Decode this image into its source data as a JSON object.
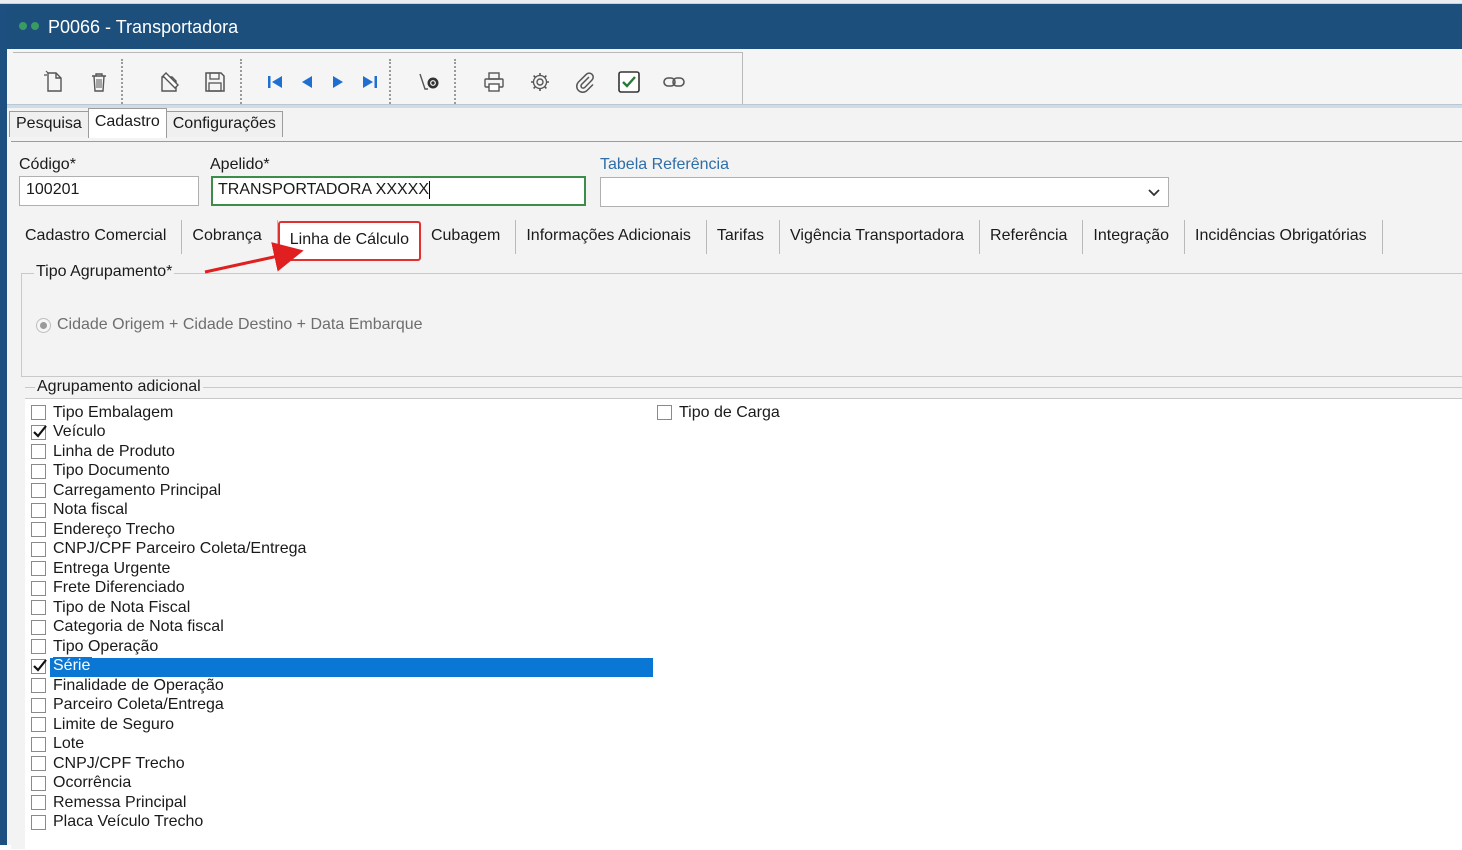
{
  "window": {
    "title": "P0066 - Transportadora"
  },
  "toolbar": {
    "buttons": [
      {
        "name": "new-icon"
      },
      {
        "name": "delete-icon"
      },
      {
        "name": "edit-icon"
      },
      {
        "name": "save-icon"
      },
      {
        "name": "first-icon"
      },
      {
        "name": "previous-icon"
      },
      {
        "name": "next-icon"
      },
      {
        "name": "last-icon"
      },
      {
        "name": "search-records-icon"
      },
      {
        "name": "print-icon"
      },
      {
        "name": "settings-icon"
      },
      {
        "name": "attach-icon"
      },
      {
        "name": "checklist-icon"
      },
      {
        "name": "link-icon"
      }
    ]
  },
  "main_tabs": [
    {
      "label": "Pesquisa"
    },
    {
      "label": "Cadastro"
    },
    {
      "label": "Configurações"
    }
  ],
  "form": {
    "codigo_label": "Código*",
    "codigo_value": "100201",
    "apelido_label": "Apelido*",
    "apelido_value": "TRANSPORTADORA XXXXX",
    "tabela_label": "Tabela Referência",
    "tabela_value": ""
  },
  "sub_tabs": [
    {
      "label": "Cadastro Comercial"
    },
    {
      "label": "Cobrança"
    },
    {
      "label": "Linha de Cálculo"
    },
    {
      "label": "Cubagem"
    },
    {
      "label": "Informações Adicionais"
    },
    {
      "label": "Tarifas"
    },
    {
      "label": "Vigência Transportadora"
    },
    {
      "label": "Referência"
    },
    {
      "label": "Integração"
    },
    {
      "label": "Incidências Obrigatórias"
    }
  ],
  "tipo_agrupamento": {
    "title": "Tipo Agrupamento*",
    "option": "Cidade Origem + Cidade Destino + Data Embarque"
  },
  "agrupamento_adicional": {
    "title": "Agrupamento adicional",
    "items": [
      {
        "label": "Tipo Embalagem",
        "checked": false
      },
      {
        "label": "Veículo",
        "checked": true
      },
      {
        "label": "Linha de Produto",
        "checked": false
      },
      {
        "label": "Tipo Documento",
        "checked": false
      },
      {
        "label": "Carregamento Principal",
        "checked": false
      },
      {
        "label": "Nota fiscal",
        "checked": false
      },
      {
        "label": "Endereço Trecho",
        "checked": false
      },
      {
        "label": "CNPJ/CPF Parceiro Coleta/Entrega",
        "checked": false
      },
      {
        "label": "Entrega Urgente",
        "checked": false
      },
      {
        "label": "Frete Diferenciado",
        "checked": false
      },
      {
        "label": "Tipo de Nota Fiscal",
        "checked": false
      },
      {
        "label": "Categoria de Nota fiscal",
        "checked": false
      },
      {
        "label": "Tipo Operação",
        "checked": false
      },
      {
        "label": "Série",
        "checked": true
      },
      {
        "label": "Finalidade de Operação",
        "checked": false
      },
      {
        "label": "Parceiro Coleta/Entrega",
        "checked": false
      },
      {
        "label": "Limite de Seguro",
        "checked": false
      },
      {
        "label": "Lote",
        "checked": false
      },
      {
        "label": "CNPJ/CPF Trecho",
        "checked": false
      },
      {
        "label": "Ocorrência",
        "checked": false
      },
      {
        "label": "Remessa Principal",
        "checked": false
      },
      {
        "label": "Placa Veículo Trecho",
        "checked": false
      }
    ],
    "right_item": {
      "label": "Tipo de Carga",
      "checked": false
    }
  },
  "colors": {
    "titlebar": "#1c4f7c",
    "selection": "#0a77d5",
    "highlight_box": "#e03030",
    "focus_border": "#3d8d4a"
  }
}
